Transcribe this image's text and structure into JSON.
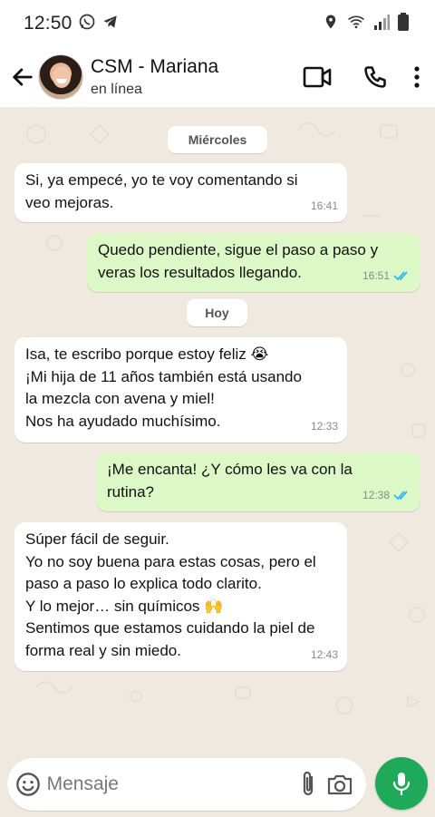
{
  "status_bar": {
    "time": "12:50",
    "icons": [
      "whatsapp-icon",
      "telegram-icon",
      "location-icon",
      "wifi-icon",
      "signal-icon",
      "battery-icon"
    ]
  },
  "header": {
    "contact_name": "CSM - Mariana",
    "contact_status": "en línea",
    "icons": [
      "back-arrow-icon",
      "video-call-icon",
      "phone-icon",
      "more-options-icon"
    ]
  },
  "chat": {
    "day_chips": [
      "Miércoles",
      "Hoy"
    ],
    "messages": [
      {
        "direction": "in",
        "text": "Si, ya empecé, yo te voy comentando si\nveo mejoras.",
        "time": "16:41"
      },
      {
        "direction": "out",
        "text": "Quedo pendiente, sigue el paso a paso y\nveras los resultados llegando.",
        "time": "16:51",
        "status": "read"
      },
      {
        "direction": "in",
        "text": "Isa, te escribo porque estoy feliz 😭\n¡Mi hija de 11 años también está usando\nla mezcla con avena y miel!\nNos ha ayudado muchísimo.",
        "time": "12:33"
      },
      {
        "direction": "out",
        "text": "¡Me encanta! ¿Y cómo les va con la\nrutina?",
        "time": "12:38",
        "status": "read"
      },
      {
        "direction": "in",
        "text": "Súper fácil de seguir.\nYo no soy buena para estas cosas, pero el\npaso a paso lo explica todo clarito.\nY lo mejor… sin químicos 🙌\nSentimos que estamos cuidando la piel de\nforma real y sin miedo.",
        "time": "12:43"
      }
    ]
  },
  "composer": {
    "placeholder": "Mensaje",
    "icons": [
      "emoji-icon",
      "attach-icon",
      "camera-icon",
      "microphone-icon"
    ]
  },
  "colors": {
    "chat_background": "#efe9e0",
    "outgoing_bubble": "#dcf8c6",
    "incoming_bubble": "#ffffff",
    "read_ticks": "#34b7f1",
    "mic_button": "#1faa59"
  }
}
